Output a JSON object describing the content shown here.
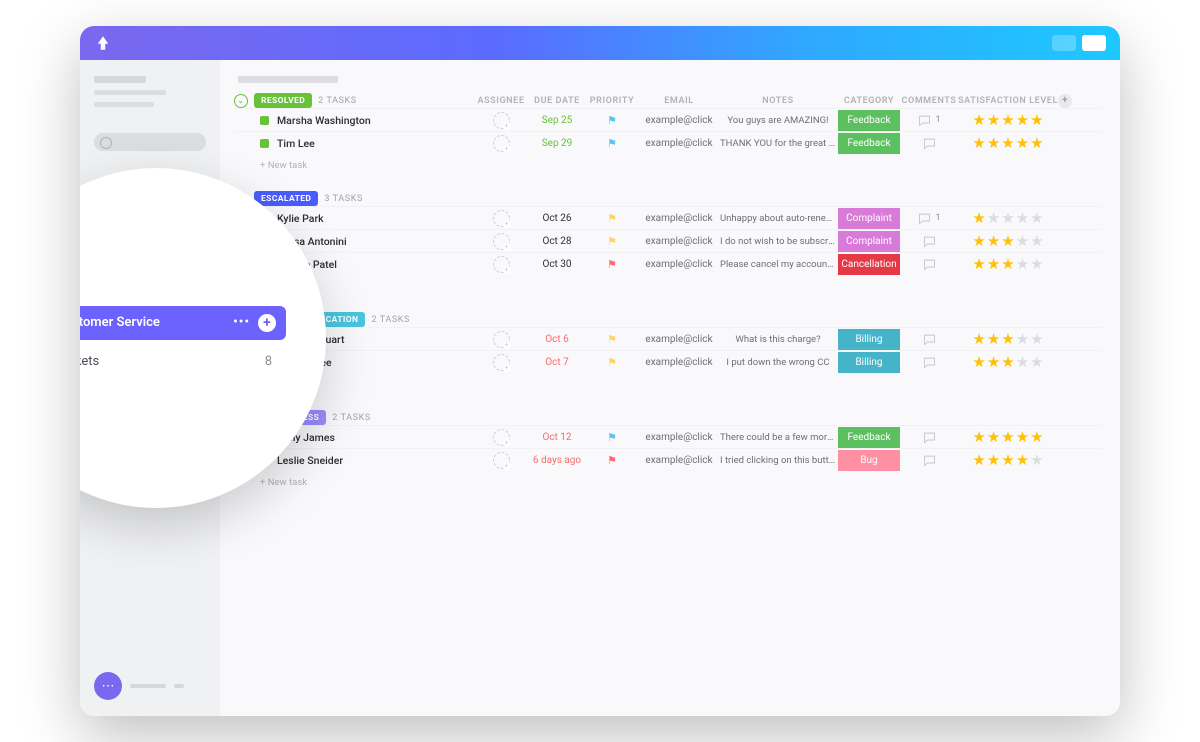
{
  "sidebar_zoom": {
    "folder_label": "Customer Service",
    "list_label": "Tickets",
    "list_count": "8"
  },
  "columns": [
    "ASSIGNEE",
    "DUE DATE",
    "PRIORITY",
    "EMAIL",
    "NOTES",
    "CATEGORY",
    "COMMENTS",
    "SATISFACTION LEVEL"
  ],
  "new_task_label": "+ New task",
  "groups": [
    {
      "status": "RESOLVED",
      "status_color": "#67c23a",
      "accent": "#67c23a",
      "count": "2 TASKS",
      "show_headers": true,
      "tasks": [
        {
          "name": "Marsha Washington",
          "sq": "#67c23a",
          "due": "Sep 25",
          "due_cls": "due-soon",
          "prio": "flag-low",
          "email": "example@click",
          "note": "You guys are AMAZING!",
          "cat": "Feedback",
          "cat_color": "#5cbf60",
          "comments": "1",
          "stars": 5
        },
        {
          "name": "Tim Lee",
          "sq": "#67c23a",
          "due": "Sep 29",
          "due_cls": "due-soon",
          "prio": "flag-low",
          "email": "example@click",
          "note": "THANK YOU for the great se…",
          "cat": "Feedback",
          "cat_color": "#5cbf60",
          "comments": "",
          "stars": 5
        }
      ]
    },
    {
      "status": "ESCALATED",
      "status_color": "#4a5cff",
      "accent": "#4a5cff",
      "count": "3 TASKS",
      "tasks": [
        {
          "name": "Kylie Park",
          "sq": "#4a5cff",
          "due": "Oct 26",
          "due_cls": "",
          "prio": "flag-med",
          "email": "example@click",
          "note": "Unhappy about auto-renewal",
          "cat": "Complaint",
          "cat_color": "#d87ad8",
          "comments": "1",
          "stars": 1
        },
        {
          "name": "Tessa Antonini",
          "sq": "#4a5cff",
          "due": "Oct 28",
          "due_cls": "",
          "prio": "flag-med",
          "email": "example@click",
          "note": "I do not wish to be subscribe…",
          "cat": "Complaint",
          "cat_color": "#d87ad8",
          "comments": "",
          "stars": 3
        },
        {
          "name": "Natalie Patel",
          "sq": "#4a5cff",
          "due": "Oct 30",
          "due_cls": "",
          "prio": "flag-high",
          "email": "example@click",
          "note": "Please cancel my account im…",
          "cat": "Cancellation",
          "cat_color": "#e63946",
          "comments": "",
          "stars": 3
        }
      ]
    },
    {
      "status": "NEEDS CLARIFICATION",
      "status_color": "#49c5e0",
      "accent": "#49c5e0",
      "count": "2 TASKS",
      "tasks": [
        {
          "name": "Jessica Stuart",
          "sq": "#49c5e0",
          "due": "Oct 6",
          "due_cls": "due-late",
          "prio": "flag-med",
          "email": "example@click",
          "note": "What is this charge?",
          "cat": "Billing",
          "cat_color": "#45b4c9",
          "comments": "",
          "stars": 3
        },
        {
          "name": "Tom Mckee",
          "sq": "#49c5e0",
          "due": "Oct 7",
          "due_cls": "due-late",
          "prio": "flag-med",
          "email": "example@click",
          "note": "I put down the wrong CC",
          "cat": "Billing",
          "cat_color": "#45b4c9",
          "comments": "",
          "stars": 3
        }
      ]
    },
    {
      "status": "IN PROGRESS",
      "status_color": "#9b8cff",
      "accent": "#9b8cff",
      "count": "2 TASKS",
      "tasks": [
        {
          "name": "Nelly James",
          "sq": "#9b8cff",
          "due": "Oct 12",
          "due_cls": "due-late",
          "prio": "flag-low",
          "email": "example@click",
          "note": "There could be a few more i…",
          "cat": "Feedback",
          "cat_color": "#5cbf60",
          "comments": "",
          "stars": 5
        },
        {
          "name": "Leslie Sneider",
          "sq": "#9b8cff",
          "due": "6 days ago",
          "due_cls": "due-late",
          "prio": "flag-high",
          "email": "example@click",
          "note": "I tried clicking on this button…",
          "cat": "Bug",
          "cat_color": "#ff8fa3",
          "comments": "",
          "stars": 4
        }
      ]
    }
  ]
}
